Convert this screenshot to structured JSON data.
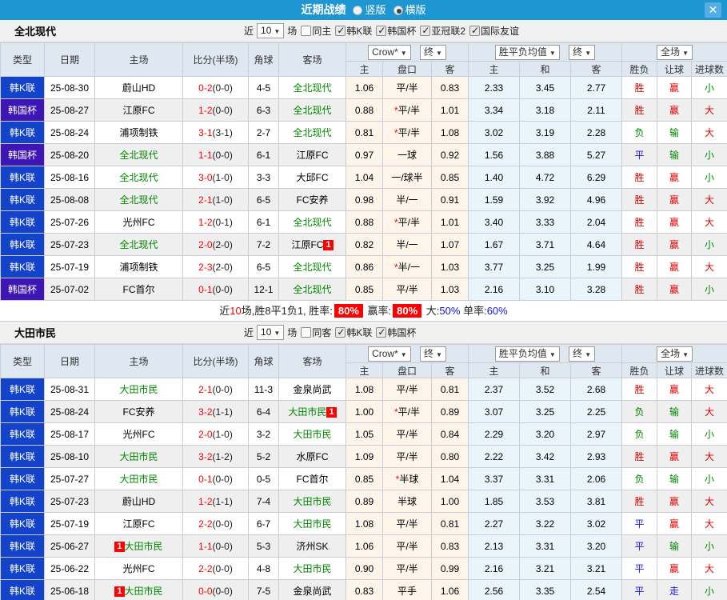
{
  "titlebar": {
    "title": "近期战绩",
    "vertical_label": "竖版",
    "horizontal_label": "横版",
    "selected_layout": "横版",
    "close_icon": "✕"
  },
  "table_header": {
    "type": "类型",
    "date": "日期",
    "home": "主场",
    "score": "比分(半场)",
    "corner": "角球",
    "away": "客场",
    "crow_select": "Crow*",
    "final_select": "终",
    "avg_select": "胜平负均值",
    "full_select": "全场",
    "sub_home": "主",
    "sub_handicap": "盘口",
    "sub_away": "客",
    "sub_avg_home": "主",
    "sub_avg_draw": "和",
    "sub_avg_away": "客",
    "result": "胜负",
    "handicap_result": "让球",
    "goals": "进球数"
  },
  "sections": [
    {
      "team": "全北现代",
      "filter": {
        "prefix": "近",
        "count": "10",
        "suffix": "场",
        "checkboxes": [
          {
            "label": "同主",
            "checked": false
          },
          {
            "label": "韩K联",
            "checked": true
          },
          {
            "label": "韩国杯",
            "checked": true
          },
          {
            "label": "亚冠联2",
            "checked": true
          },
          {
            "label": "国际友谊",
            "checked": true
          }
        ]
      },
      "rows": [
        {
          "type": "韩K联",
          "cup": false,
          "date": "25-08-30",
          "home": {
            "name": "蔚山HD",
            "green": false
          },
          "score": "0-2",
          "half": "(0-0)",
          "corner": "4-5",
          "away": {
            "name": "全北现代",
            "green": true
          },
          "crow_home": "1.06",
          "star": false,
          "handicap": "平/半",
          "crow_away": "0.83",
          "avg_home": "2.33",
          "avg_draw": "3.45",
          "avg_away": "2.77",
          "result": [
            "胜",
            "c-r"
          ],
          "let": [
            "赢",
            "c-r"
          ],
          "goal": [
            "小",
            "c-g"
          ]
        },
        {
          "type": "韩国杯",
          "cup": true,
          "date": "25-08-27",
          "home": {
            "name": "江原FC",
            "green": false
          },
          "score": "1-2",
          "half": "(0-0)",
          "corner": "6-3",
          "away": {
            "name": "全北现代",
            "green": true
          },
          "crow_home": "0.88",
          "star": true,
          "handicap": "平/半",
          "crow_away": "1.01",
          "avg_home": "3.34",
          "avg_draw": "3.18",
          "avg_away": "2.11",
          "result": [
            "胜",
            "c-r"
          ],
          "let": [
            "赢",
            "c-r"
          ],
          "goal": [
            "大",
            "c-r"
          ]
        },
        {
          "type": "韩K联",
          "cup": false,
          "date": "25-08-24",
          "home": {
            "name": "浦项制铁",
            "green": false
          },
          "score": "3-1",
          "half": "(3-1)",
          "corner": "2-7",
          "away": {
            "name": "全北现代",
            "green": true
          },
          "crow_home": "0.81",
          "star": true,
          "handicap": "平/半",
          "crow_away": "1.08",
          "avg_home": "3.02",
          "avg_draw": "3.19",
          "avg_away": "2.28",
          "result": [
            "负",
            "c-g"
          ],
          "let": [
            "输",
            "c-g"
          ],
          "goal": [
            "大",
            "c-r"
          ]
        },
        {
          "type": "韩国杯",
          "cup": true,
          "date": "25-08-20",
          "home": {
            "name": "全北现代",
            "green": true
          },
          "score": "1-1",
          "half": "(0-0)",
          "corner": "6-1",
          "away": {
            "name": "江原FC",
            "green": false
          },
          "crow_home": "0.97",
          "star": false,
          "handicap": "一球",
          "crow_away": "0.92",
          "avg_home": "1.56",
          "avg_draw": "3.88",
          "avg_away": "5.27",
          "result": [
            "平",
            "c-b"
          ],
          "let": [
            "输",
            "c-g"
          ],
          "goal": [
            "小",
            "c-g"
          ]
        },
        {
          "type": "韩K联",
          "cup": false,
          "date": "25-08-16",
          "home": {
            "name": "全北现代",
            "green": true
          },
          "score": "3-0",
          "half": "(1-0)",
          "corner": "3-3",
          "away": {
            "name": "大邱FC",
            "green": false
          },
          "crow_home": "1.04",
          "star": false,
          "handicap": "一/球半",
          "crow_away": "0.85",
          "avg_home": "1.40",
          "avg_draw": "4.72",
          "avg_away": "6.29",
          "result": [
            "胜",
            "c-r"
          ],
          "let": [
            "赢",
            "c-r"
          ],
          "goal": [
            "小",
            "c-g"
          ]
        },
        {
          "type": "韩K联",
          "cup": false,
          "date": "25-08-08",
          "home": {
            "name": "全北现代",
            "green": true
          },
          "score": "2-1",
          "half": "(1-0)",
          "corner": "6-5",
          "away": {
            "name": "FC安养",
            "green": false
          },
          "crow_home": "0.98",
          "star": false,
          "handicap": "半/一",
          "crow_away": "0.91",
          "avg_home": "1.59",
          "avg_draw": "3.92",
          "avg_away": "4.96",
          "result": [
            "胜",
            "c-r"
          ],
          "let": [
            "赢",
            "c-r"
          ],
          "goal": [
            "大",
            "c-r"
          ]
        },
        {
          "type": "韩K联",
          "cup": false,
          "date": "25-07-26",
          "home": {
            "name": "光州FC",
            "green": false
          },
          "score": "1-2",
          "half": "(0-1)",
          "corner": "6-1",
          "away": {
            "name": "全北现代",
            "green": true
          },
          "crow_home": "0.88",
          "star": true,
          "handicap": "平/半",
          "crow_away": "1.01",
          "avg_home": "3.40",
          "avg_draw": "3.33",
          "avg_away": "2.04",
          "result": [
            "胜",
            "c-r"
          ],
          "let": [
            "赢",
            "c-r"
          ],
          "goal": [
            "大",
            "c-r"
          ]
        },
        {
          "type": "韩K联",
          "cup": false,
          "date": "25-07-23",
          "home": {
            "name": "全北现代",
            "green": true
          },
          "score": "2-0",
          "half": "(2-0)",
          "corner": "7-2",
          "away": {
            "name": "江原FC",
            "green": false,
            "badge": "1",
            "badge_pos": "after"
          },
          "crow_home": "0.82",
          "star": false,
          "handicap": "半/一",
          "crow_away": "1.07",
          "avg_home": "1.67",
          "avg_draw": "3.71",
          "avg_away": "4.64",
          "result": [
            "胜",
            "c-r"
          ],
          "let": [
            "赢",
            "c-r"
          ],
          "goal": [
            "小",
            "c-g"
          ]
        },
        {
          "type": "韩K联",
          "cup": false,
          "date": "25-07-19",
          "home": {
            "name": "浦项制铁",
            "green": false
          },
          "score": "2-3",
          "half": "(2-0)",
          "corner": "6-5",
          "away": {
            "name": "全北现代",
            "green": true
          },
          "crow_home": "0.86",
          "star": true,
          "handicap": "半/一",
          "crow_away": "1.03",
          "avg_home": "3.77",
          "avg_draw": "3.25",
          "avg_away": "1.99",
          "result": [
            "胜",
            "c-r"
          ],
          "let": [
            "赢",
            "c-r"
          ],
          "goal": [
            "大",
            "c-r"
          ]
        },
        {
          "type": "韩国杯",
          "cup": true,
          "date": "25-07-02",
          "home": {
            "name": "FC首尔",
            "green": false
          },
          "score": "0-1",
          "half": "(0-0)",
          "corner": "12-1",
          "away": {
            "name": "全北现代",
            "green": true
          },
          "crow_home": "0.85",
          "star": false,
          "handicap": "平/半",
          "crow_away": "1.03",
          "avg_home": "2.16",
          "avg_draw": "3.10",
          "avg_away": "3.28",
          "result": [
            "胜",
            "c-r"
          ],
          "let": [
            "赢",
            "c-r"
          ],
          "goal": [
            "小",
            "c-g"
          ]
        }
      ],
      "summary": {
        "segments": [
          {
            "t": "近"
          },
          {
            "t": "10",
            "c": "c-r"
          },
          {
            "t": "场,胜8平1负1, 胜率:"
          },
          {
            "t": "80%",
            "c": "pct"
          },
          {
            "t": " 赢率:"
          },
          {
            "t": "80%",
            "c": "pct"
          },
          {
            "t": " 大:"
          },
          {
            "t": "50%",
            "c": "c-b"
          },
          {
            "t": " 单率:"
          },
          {
            "t": "60%",
            "c": "c-b"
          }
        ]
      }
    },
    {
      "team": "大田市民",
      "filter": {
        "prefix": "近",
        "count": "10",
        "suffix": "场",
        "checkboxes": [
          {
            "label": "同客",
            "checked": false
          },
          {
            "label": "韩K联",
            "checked": true
          },
          {
            "label": "韩国杯",
            "checked": true
          }
        ]
      },
      "rows": [
        {
          "type": "韩K联",
          "cup": false,
          "date": "25-08-31",
          "home": {
            "name": "大田市民",
            "green": true
          },
          "score": "2-1",
          "half": "(0-0)",
          "corner": "11-3",
          "away": {
            "name": "金泉尚武",
            "green": false
          },
          "crow_home": "1.08",
          "star": false,
          "handicap": "平/半",
          "crow_away": "0.81",
          "avg_home": "2.37",
          "avg_draw": "3.52",
          "avg_away": "2.68",
          "result": [
            "胜",
            "c-r"
          ],
          "let": [
            "赢",
            "c-r"
          ],
          "goal": [
            "大",
            "c-r"
          ]
        },
        {
          "type": "韩K联",
          "cup": false,
          "date": "25-08-24",
          "home": {
            "name": "FC安养",
            "green": false
          },
          "score": "3-2",
          "half": "(1-1)",
          "corner": "6-4",
          "away": {
            "name": "大田市民",
            "green": true,
            "badge": "1",
            "badge_pos": "after"
          },
          "crow_home": "1.00",
          "star": true,
          "handicap": "平/半",
          "crow_away": "0.89",
          "avg_home": "3.07",
          "avg_draw": "3.25",
          "avg_away": "2.25",
          "result": [
            "负",
            "c-g"
          ],
          "let": [
            "输",
            "c-g"
          ],
          "goal": [
            "大",
            "c-r"
          ]
        },
        {
          "type": "韩K联",
          "cup": false,
          "date": "25-08-17",
          "home": {
            "name": "光州FC",
            "green": false
          },
          "score": "2-0",
          "half": "(1-0)",
          "corner": "3-2",
          "away": {
            "name": "大田市民",
            "green": true
          },
          "crow_home": "1.05",
          "star": false,
          "handicap": "平/半",
          "crow_away": "0.84",
          "avg_home": "2.29",
          "avg_draw": "3.20",
          "avg_away": "2.97",
          "result": [
            "负",
            "c-g"
          ],
          "let": [
            "输",
            "c-g"
          ],
          "goal": [
            "小",
            "c-g"
          ]
        },
        {
          "type": "韩K联",
          "cup": false,
          "date": "25-08-10",
          "home": {
            "name": "大田市民",
            "green": true
          },
          "score": "3-2",
          "half": "(1-2)",
          "corner": "5-2",
          "away": {
            "name": "水原FC",
            "green": false
          },
          "crow_home": "1.09",
          "star": false,
          "handicap": "平/半",
          "crow_away": "0.80",
          "avg_home": "2.22",
          "avg_draw": "3.42",
          "avg_away": "2.93",
          "result": [
            "胜",
            "c-r"
          ],
          "let": [
            "赢",
            "c-r"
          ],
          "goal": [
            "大",
            "c-r"
          ]
        },
        {
          "type": "韩K联",
          "cup": false,
          "date": "25-07-27",
          "home": {
            "name": "大田市民",
            "green": true
          },
          "score": "0-1",
          "half": "(0-0)",
          "corner": "0-5",
          "away": {
            "name": "FC首尔",
            "green": false
          },
          "crow_home": "0.85",
          "star": true,
          "handicap": "半球",
          "crow_away": "1.04",
          "avg_home": "3.37",
          "avg_draw": "3.31",
          "avg_away": "2.06",
          "result": [
            "负",
            "c-g"
          ],
          "let": [
            "输",
            "c-g"
          ],
          "goal": [
            "小",
            "c-g"
          ]
        },
        {
          "type": "韩K联",
          "cup": false,
          "date": "25-07-23",
          "home": {
            "name": "蔚山HD",
            "green": false
          },
          "score": "1-2",
          "half": "(1-1)",
          "corner": "7-4",
          "away": {
            "name": "大田市民",
            "green": true
          },
          "crow_home": "0.89",
          "star": false,
          "handicap": "半球",
          "crow_away": "1.00",
          "avg_home": "1.85",
          "avg_draw": "3.53",
          "avg_away": "3.81",
          "result": [
            "胜",
            "c-r"
          ],
          "let": [
            "赢",
            "c-r"
          ],
          "goal": [
            "大",
            "c-r"
          ]
        },
        {
          "type": "韩K联",
          "cup": false,
          "date": "25-07-19",
          "home": {
            "name": "江原FC",
            "green": false
          },
          "score": "2-2",
          "half": "(0-0)",
          "corner": "6-7",
          "away": {
            "name": "大田市民",
            "green": true
          },
          "crow_home": "1.08",
          "star": false,
          "handicap": "平/半",
          "crow_away": "0.81",
          "avg_home": "2.27",
          "avg_draw": "3.22",
          "avg_away": "3.02",
          "result": [
            "平",
            "c-b"
          ],
          "let": [
            "赢",
            "c-r"
          ],
          "goal": [
            "大",
            "c-r"
          ]
        },
        {
          "type": "韩K联",
          "cup": false,
          "date": "25-06-27",
          "home": {
            "name": "大田市民",
            "green": true,
            "badge": "1",
            "badge_pos": "before"
          },
          "score": "1-1",
          "half": "(0-0)",
          "corner": "5-3",
          "away": {
            "name": "济州SK",
            "green": false
          },
          "crow_home": "1.06",
          "star": false,
          "handicap": "平/半",
          "crow_away": "0.83",
          "avg_home": "2.13",
          "avg_draw": "3.31",
          "avg_away": "3.20",
          "result": [
            "平",
            "c-b"
          ],
          "let": [
            "输",
            "c-g"
          ],
          "goal": [
            "小",
            "c-g"
          ]
        },
        {
          "type": "韩K联",
          "cup": false,
          "date": "25-06-22",
          "home": {
            "name": "光州FC",
            "green": false
          },
          "score": "2-2",
          "half": "(0-0)",
          "corner": "4-8",
          "away": {
            "name": "大田市民",
            "green": true
          },
          "crow_home": "0.90",
          "star": false,
          "handicap": "平/半",
          "crow_away": "0.99",
          "avg_home": "2.16",
          "avg_draw": "3.21",
          "avg_away": "3.21",
          "result": [
            "平",
            "c-b"
          ],
          "let": [
            "赢",
            "c-r"
          ],
          "goal": [
            "大",
            "c-r"
          ]
        },
        {
          "type": "韩K联",
          "cup": false,
          "date": "25-06-18",
          "home": {
            "name": "大田市民",
            "green": true,
            "badge": "1",
            "badge_pos": "before"
          },
          "score": "0-0",
          "half": "(0-0)",
          "corner": "7-5",
          "away": {
            "name": "金泉尚武",
            "green": false
          },
          "crow_home": "0.83",
          "star": false,
          "handicap": "平手",
          "crow_away": "1.06",
          "avg_home": "2.56",
          "avg_draw": "3.35",
          "avg_away": "2.54",
          "result": [
            "平",
            "c-b"
          ],
          "let": [
            "走",
            "c-b"
          ],
          "goal": [
            "小",
            "c-g"
          ]
        }
      ],
      "summary": null
    }
  ]
}
